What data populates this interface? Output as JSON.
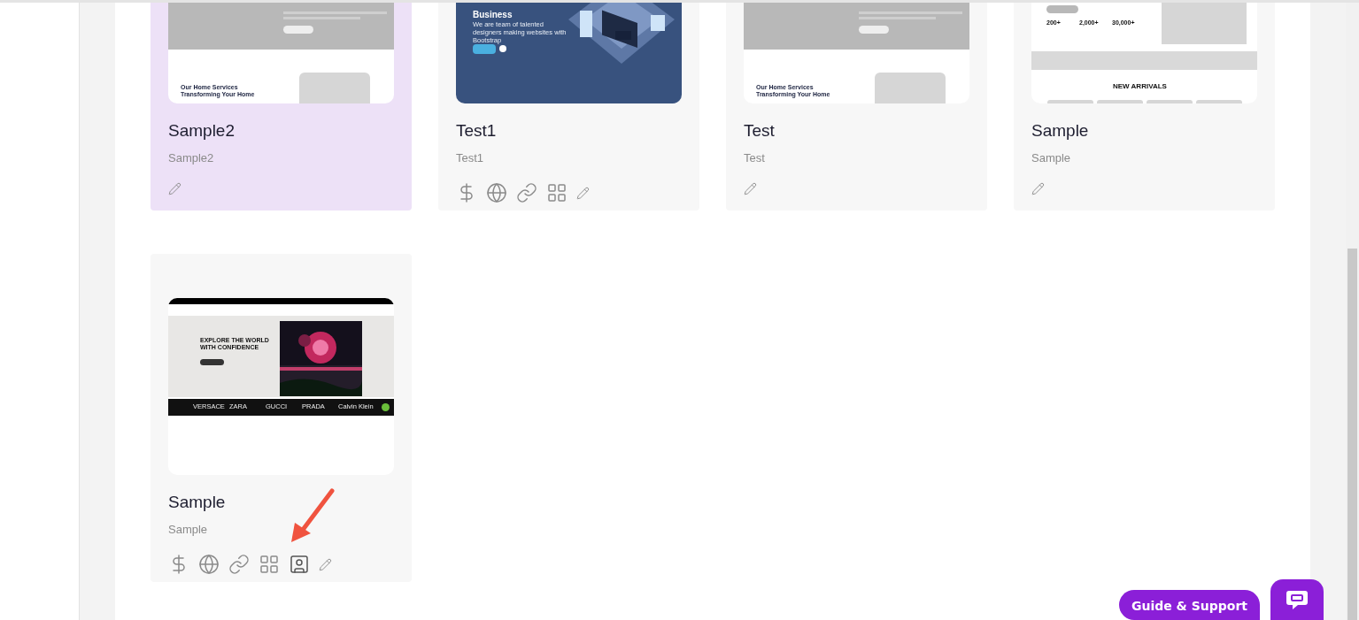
{
  "cards": [
    {
      "title": "Sample2",
      "subtitle": "Sample2",
      "selected": true,
      "thumbnail": {
        "kind": "home-services",
        "section": "Our Home Services Transforming Your Home"
      },
      "actions": [
        {
          "kind": "edit",
          "highlighted": false
        }
      ]
    },
    {
      "title": "Test1",
      "subtitle": "Test1",
      "selected": false,
      "thumbnail": {
        "kind": "business",
        "heading": "Business",
        "tagline": "We are team of talented designers making websites with Bootstrap"
      },
      "actions": [
        {
          "kind": "dollar",
          "highlighted": false
        },
        {
          "kind": "globe",
          "highlighted": false
        },
        {
          "kind": "link",
          "highlighted": false
        },
        {
          "kind": "grid",
          "highlighted": false
        },
        {
          "kind": "edit",
          "highlighted": false
        }
      ]
    },
    {
      "title": "Test",
      "subtitle": "Test",
      "selected": false,
      "thumbnail": {
        "kind": "home-services",
        "section": "Our Home Services Transforming Your Home"
      },
      "actions": [
        {
          "kind": "edit",
          "highlighted": false
        }
      ]
    },
    {
      "title": "Sample",
      "subtitle": "Sample",
      "selected": false,
      "thumbnail": {
        "kind": "shop-stats",
        "stats": [
          "200+",
          "2,000+",
          "30,000+"
        ],
        "section": "NEW ARRIVALS"
      },
      "actions": [
        {
          "kind": "edit",
          "highlighted": false
        }
      ]
    },
    {
      "title": "Sample",
      "subtitle": "Sample",
      "selected": false,
      "thumbnail": {
        "kind": "shop-hero",
        "heading": "EXPLORE THE WORLD WITH CONFIDENCE",
        "brands": [
          "VERSACE",
          "ZARA",
          "GUCCI",
          "PRADA",
          "Calvin Klein"
        ]
      },
      "actions": [
        {
          "kind": "dollar",
          "highlighted": false
        },
        {
          "kind": "globe",
          "highlighted": false
        },
        {
          "kind": "link",
          "highlighted": false
        },
        {
          "kind": "grid",
          "highlighted": false
        },
        {
          "kind": "contact",
          "highlighted": true
        },
        {
          "kind": "edit",
          "highlighted": false
        }
      ]
    }
  ],
  "support": {
    "label": "Guide & Support"
  }
}
